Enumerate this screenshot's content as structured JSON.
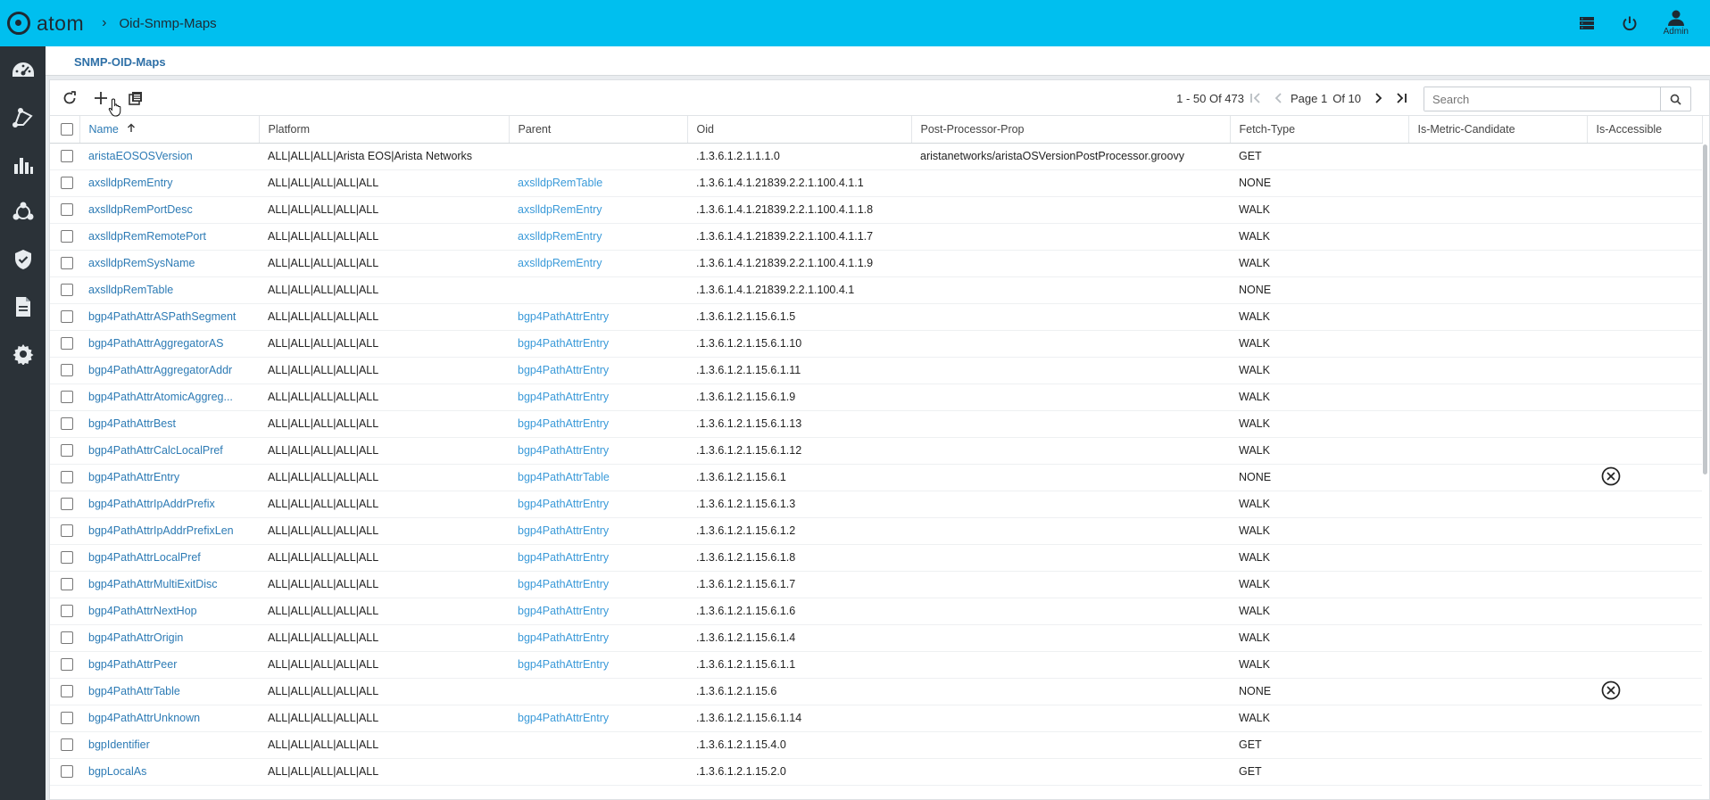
{
  "app": {
    "logo_text": "atom",
    "breadcrumb": "Oid-Snmp-Maps",
    "user_label": "Admin"
  },
  "sidebar": {
    "items": [
      "dashboard-icon",
      "topology-icon",
      "analytics-icon",
      "network-icon",
      "security-icon",
      "document-icon",
      "settings-icon"
    ]
  },
  "subheader": {
    "title": "SNMP-OID-Maps"
  },
  "pager": {
    "range": "1 - 50 Of 473",
    "page": "Page 1",
    "of": "Of 10"
  },
  "search": {
    "placeholder": "Search",
    "value": ""
  },
  "columns": [
    "Name",
    "Platform",
    "Parent",
    "Oid",
    "Post-Processor-Prop",
    "Fetch-Type",
    "Is-Metric-Candidate",
    "Is-Accessible"
  ],
  "rows": [
    {
      "name": "aristaEOSOSVersion",
      "platform": "ALL|ALL|ALL|Arista EOS|Arista Networks",
      "parent": "",
      "oid": ".1.3.6.1.2.1.1.1.0",
      "post": "aristanetworks/aristaOSVersionPostProcessor.groovy",
      "fetch": "GET",
      "metric": "",
      "accessible": ""
    },
    {
      "name": "axslldpRemEntry",
      "platform": "ALL|ALL|ALL|ALL|ALL",
      "parent": "axslldpRemTable",
      "oid": ".1.3.6.1.4.1.21839.2.2.1.100.4.1.1",
      "post": "",
      "fetch": "NONE",
      "metric": "",
      "accessible": ""
    },
    {
      "name": "axslldpRemPortDesc",
      "platform": "ALL|ALL|ALL|ALL|ALL",
      "parent": "axslldpRemEntry",
      "oid": ".1.3.6.1.4.1.21839.2.2.1.100.4.1.1.8",
      "post": "",
      "fetch": "WALK",
      "metric": "",
      "accessible": ""
    },
    {
      "name": "axslldpRemRemotePort",
      "platform": "ALL|ALL|ALL|ALL|ALL",
      "parent": "axslldpRemEntry",
      "oid": ".1.3.6.1.4.1.21839.2.2.1.100.4.1.1.7",
      "post": "",
      "fetch": "WALK",
      "metric": "",
      "accessible": ""
    },
    {
      "name": "axslldpRemSysName",
      "platform": "ALL|ALL|ALL|ALL|ALL",
      "parent": "axslldpRemEntry",
      "oid": ".1.3.6.1.4.1.21839.2.2.1.100.4.1.1.9",
      "post": "",
      "fetch": "WALK",
      "metric": "",
      "accessible": ""
    },
    {
      "name": "axslldpRemTable",
      "platform": "ALL|ALL|ALL|ALL|ALL",
      "parent": "",
      "oid": ".1.3.6.1.4.1.21839.2.2.1.100.4.1",
      "post": "",
      "fetch": "NONE",
      "metric": "",
      "accessible": ""
    },
    {
      "name": "bgp4PathAttrASPathSegment",
      "platform": "ALL|ALL|ALL|ALL|ALL",
      "parent": "bgp4PathAttrEntry",
      "oid": ".1.3.6.1.2.1.15.6.1.5",
      "post": "",
      "fetch": "WALK",
      "metric": "",
      "accessible": ""
    },
    {
      "name": "bgp4PathAttrAggregatorAS",
      "platform": "ALL|ALL|ALL|ALL|ALL",
      "parent": "bgp4PathAttrEntry",
      "oid": ".1.3.6.1.2.1.15.6.1.10",
      "post": "",
      "fetch": "WALK",
      "metric": "",
      "accessible": ""
    },
    {
      "name": "bgp4PathAttrAggregatorAddr",
      "platform": "ALL|ALL|ALL|ALL|ALL",
      "parent": "bgp4PathAttrEntry",
      "oid": ".1.3.6.1.2.1.15.6.1.11",
      "post": "",
      "fetch": "WALK",
      "metric": "",
      "accessible": ""
    },
    {
      "name": "bgp4PathAttrAtomicAggreg...",
      "platform": "ALL|ALL|ALL|ALL|ALL",
      "parent": "bgp4PathAttrEntry",
      "oid": ".1.3.6.1.2.1.15.6.1.9",
      "post": "",
      "fetch": "WALK",
      "metric": "",
      "accessible": ""
    },
    {
      "name": "bgp4PathAttrBest",
      "platform": "ALL|ALL|ALL|ALL|ALL",
      "parent": "bgp4PathAttrEntry",
      "oid": ".1.3.6.1.2.1.15.6.1.13",
      "post": "",
      "fetch": "WALK",
      "metric": "",
      "accessible": ""
    },
    {
      "name": "bgp4PathAttrCalcLocalPref",
      "platform": "ALL|ALL|ALL|ALL|ALL",
      "parent": "bgp4PathAttrEntry",
      "oid": ".1.3.6.1.2.1.15.6.1.12",
      "post": "",
      "fetch": "WALK",
      "metric": "",
      "accessible": ""
    },
    {
      "name": "bgp4PathAttrEntry",
      "platform": "ALL|ALL|ALL|ALL|ALL",
      "parent": "bgp4PathAttrTable",
      "oid": ".1.3.6.1.2.1.15.6.1",
      "post": "",
      "fetch": "NONE",
      "metric": "",
      "accessible": "x"
    },
    {
      "name": "bgp4PathAttrIpAddrPrefix",
      "platform": "ALL|ALL|ALL|ALL|ALL",
      "parent": "bgp4PathAttrEntry",
      "oid": ".1.3.6.1.2.1.15.6.1.3",
      "post": "",
      "fetch": "WALK",
      "metric": "",
      "accessible": ""
    },
    {
      "name": "bgp4PathAttrIpAddrPrefixLen",
      "platform": "ALL|ALL|ALL|ALL|ALL",
      "parent": "bgp4PathAttrEntry",
      "oid": ".1.3.6.1.2.1.15.6.1.2",
      "post": "",
      "fetch": "WALK",
      "metric": "",
      "accessible": ""
    },
    {
      "name": "bgp4PathAttrLocalPref",
      "platform": "ALL|ALL|ALL|ALL|ALL",
      "parent": "bgp4PathAttrEntry",
      "oid": ".1.3.6.1.2.1.15.6.1.8",
      "post": "",
      "fetch": "WALK",
      "metric": "",
      "accessible": ""
    },
    {
      "name": "bgp4PathAttrMultiExitDisc",
      "platform": "ALL|ALL|ALL|ALL|ALL",
      "parent": "bgp4PathAttrEntry",
      "oid": ".1.3.6.1.2.1.15.6.1.7",
      "post": "",
      "fetch": "WALK",
      "metric": "",
      "accessible": ""
    },
    {
      "name": "bgp4PathAttrNextHop",
      "platform": "ALL|ALL|ALL|ALL|ALL",
      "parent": "bgp4PathAttrEntry",
      "oid": ".1.3.6.1.2.1.15.6.1.6",
      "post": "",
      "fetch": "WALK",
      "metric": "",
      "accessible": ""
    },
    {
      "name": "bgp4PathAttrOrigin",
      "platform": "ALL|ALL|ALL|ALL|ALL",
      "parent": "bgp4PathAttrEntry",
      "oid": ".1.3.6.1.2.1.15.6.1.4",
      "post": "",
      "fetch": "WALK",
      "metric": "",
      "accessible": ""
    },
    {
      "name": "bgp4PathAttrPeer",
      "platform": "ALL|ALL|ALL|ALL|ALL",
      "parent": "bgp4PathAttrEntry",
      "oid": ".1.3.6.1.2.1.15.6.1.1",
      "post": "",
      "fetch": "WALK",
      "metric": "",
      "accessible": ""
    },
    {
      "name": "bgp4PathAttrTable",
      "platform": "ALL|ALL|ALL|ALL|ALL",
      "parent": "",
      "oid": ".1.3.6.1.2.1.15.6",
      "post": "",
      "fetch": "NONE",
      "metric": "",
      "accessible": "x"
    },
    {
      "name": "bgp4PathAttrUnknown",
      "platform": "ALL|ALL|ALL|ALL|ALL",
      "parent": "bgp4PathAttrEntry",
      "oid": ".1.3.6.1.2.1.15.6.1.14",
      "post": "",
      "fetch": "WALK",
      "metric": "",
      "accessible": ""
    },
    {
      "name": "bgpIdentifier",
      "platform": "ALL|ALL|ALL|ALL|ALL",
      "parent": "",
      "oid": ".1.3.6.1.2.1.15.4.0",
      "post": "",
      "fetch": "GET",
      "metric": "",
      "accessible": ""
    },
    {
      "name": "bgpLocalAs",
      "platform": "ALL|ALL|ALL|ALL|ALL",
      "parent": "",
      "oid": ".1.3.6.1.2.1.15.2.0",
      "post": "",
      "fetch": "GET",
      "metric": "",
      "accessible": ""
    }
  ]
}
